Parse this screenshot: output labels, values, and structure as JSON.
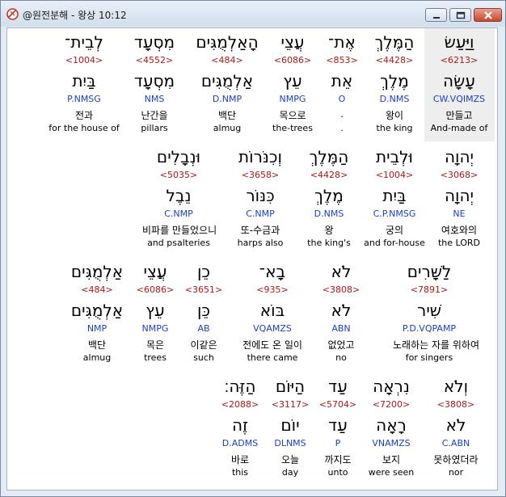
{
  "window": {
    "title": "@원전분해 - 왕상 10:12",
    "colors": {
      "strong": "#b01818",
      "parse": "#1a3fc8",
      "text": "#000000"
    }
  },
  "rows": [
    {
      "words": [
        {
          "hebrew": "וַיַּעַשׂ",
          "strong": "<6213>",
          "lexeme": "עָשָׂה",
          "parse": "CW.VQIMZS",
          "korean": "만들고",
          "english": "And-made of",
          "selected": true
        },
        {
          "hebrew": "הַמֶּלֶךְ",
          "strong": "<4428>",
          "lexeme": "מֶלֶךְ",
          "parse": "D.NMS",
          "korean": "왕이",
          "english": "the king"
        },
        {
          "hebrew": "אֶת־",
          "strong": "<853>",
          "lexeme": "אֵת",
          "parse": "O",
          "korean": ".",
          "english": "."
        },
        {
          "hebrew": "עֲצֵי",
          "strong": "<6086>",
          "lexeme": "עֵץ",
          "parse": "NMPG",
          "korean": "목으로",
          "english": "the-trees"
        },
        {
          "hebrew": "הָאַלְמֻגִּים",
          "strong": "<484>",
          "lexeme": "אַלְמֻגִּים",
          "parse": "D.NMP",
          "korean": "백단",
          "english": "almug"
        },
        {
          "hebrew": "מִסְעָד",
          "strong": "<4552>",
          "lexeme": "מִסְעָד",
          "parse": "NMS",
          "korean": "난간을",
          "english": "pillars"
        },
        {
          "hebrew": "לְבֵית־",
          "strong": "<1004>",
          "lexeme": "בַּיִת",
          "parse": "P.NMSG",
          "korean": "전과",
          "english": "for the house of"
        }
      ]
    },
    {
      "words": [
        {
          "hebrew": "יְהוָה",
          "strong": "<3068>",
          "lexeme": "יְהוָה",
          "parse": "NE",
          "korean": "여호와의",
          "english": "the LORD"
        },
        {
          "hebrew": "וּלְבֵית",
          "strong": "<1004>",
          "lexeme": "בַּיִת",
          "parse": "C.P.NMSG",
          "korean": "궁의",
          "english": "and for-house"
        },
        {
          "hebrew": "הַמֶּלֶךְ",
          "strong": "<4428>",
          "lexeme": "מֶלֶךְ",
          "parse": "D.NMS",
          "korean": "왕",
          "english": "the king's"
        },
        {
          "hebrew": "וְכִנֹּרוֹת",
          "strong": "<3658>",
          "lexeme": "כִּנּוֹר",
          "parse": "C.NMP",
          "korean": "또-수금과",
          "english": "harps also"
        },
        {
          "hebrew": "וּנְבָלִים",
          "strong": "<5035>",
          "lexeme": "נֵבֶל",
          "parse": "C.NMP",
          "korean": "비파를 만들었으니",
          "english": "and psalteries"
        }
      ]
    },
    {
      "words": [
        {
          "hebrew": "לַשָּׁרִים",
          "strong": "<7891>",
          "lexeme": "שִׁיר",
          "parse": "P.D.VQPAMP",
          "korean": "노래하는 자를 위하여",
          "english": "for singers"
        },
        {
          "hebrew": "לֹא",
          "strong": "<3808>",
          "lexeme": "לֹא",
          "parse": "ABN",
          "korean": "없었고",
          "english": "no"
        },
        {
          "hebrew": "בָא־",
          "strong": "<935>",
          "lexeme": "בּוֹא",
          "parse": "VQAMZS",
          "korean": "전에도 온 일이",
          "english": "there came"
        },
        {
          "hebrew": "כֵן",
          "strong": "<3651>",
          "lexeme": "כֵּן",
          "parse": "AB",
          "korean": "이같은",
          "english": "such"
        },
        {
          "hebrew": "עֲצֵי",
          "strong": "<6086>",
          "lexeme": "עֵץ",
          "parse": "NMPG",
          "korean": "목은",
          "english": "trees"
        },
        {
          "hebrew": "אַלְמֻגִּים",
          "strong": "<484>",
          "lexeme": "אַלְמֻגִּים",
          "parse": "NMP",
          "korean": "백단",
          "english": "almug"
        }
      ]
    },
    {
      "words": [
        {
          "hebrew": "וְלֹא",
          "strong": "<3808>",
          "lexeme": "לֹא",
          "parse": "C.ABN",
          "korean": "못하였더라",
          "english": "nor"
        },
        {
          "hebrew": "נִרְאָה",
          "strong": "<7200>",
          "lexeme": "רָאָה",
          "parse": "VNAMZS",
          "korean": "보지",
          "english": "were seen"
        },
        {
          "hebrew": "עַד",
          "strong": "<5704>",
          "lexeme": "עַד",
          "parse": "P",
          "korean": "까지도",
          "english": "unto"
        },
        {
          "hebrew": "הַיּוֹם",
          "strong": "<3117>",
          "lexeme": "יוֹם",
          "parse": "DLNMS",
          "korean": "오늘",
          "english": "day"
        },
        {
          "hebrew": "הַזֶּה׃",
          "strong": "<2088>",
          "lexeme": "זֶה",
          "parse": "D.ADMS",
          "korean": "바로",
          "english": "this"
        }
      ]
    }
  ]
}
